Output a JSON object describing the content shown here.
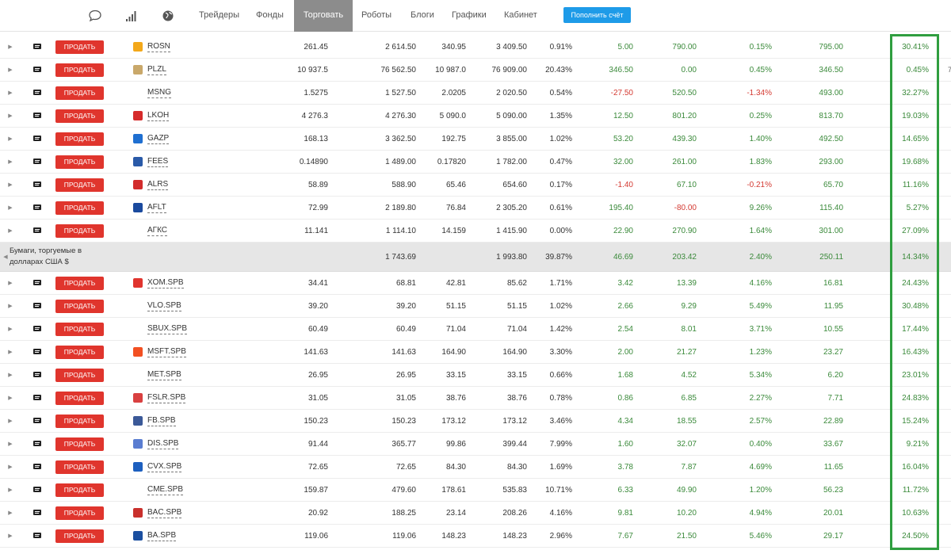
{
  "nav": {
    "links": [
      "Трейдеры",
      "Фонды",
      "Торговать",
      "Роботы",
      "Блоги",
      "Графики",
      "Кабинет"
    ],
    "fund_button": "Пополнить счёт"
  },
  "sell_label": "ПРОДАТЬ",
  "edge_mark": "7",
  "rows": [
    {
      "ticker": "ROSN",
      "v1": "261.45",
      "v2": "2 614.50",
      "v3": "340.95",
      "v4": "3 409.50",
      "v5": "0.91%",
      "v6": "5.00",
      "v7": "790.00",
      "v8": "0.15%",
      "v9": "795.00",
      "v10": "30.41%"
    },
    {
      "ticker": "PLZL",
      "v1": "10 937.5",
      "v2": "76 562.50",
      "v3": "10 987.0",
      "v4": "76 909.00",
      "v5": "20.43%",
      "v6": "346.50",
      "v7": "0.00",
      "v8": "0.45%",
      "v9": "346.50",
      "v10": "0.45%"
    },
    {
      "ticker": "MSNG",
      "v1": "1.5275",
      "v2": "1 527.50",
      "v3": "2.0205",
      "v4": "2 020.50",
      "v5": "0.54%",
      "v6": "-27.50",
      "v7": "520.50",
      "v8": "-1.34%",
      "v9": "493.00",
      "v10": "32.27%"
    },
    {
      "ticker": "LKOH",
      "v1": "4 276.3",
      "v2": "4 276.30",
      "v3": "5 090.0",
      "v4": "5 090.00",
      "v5": "1.35%",
      "v6": "12.50",
      "v7": "801.20",
      "v8": "0.25%",
      "v9": "813.70",
      "v10": "19.03%"
    },
    {
      "ticker": "GAZP",
      "v1": "168.13",
      "v2": "3 362.50",
      "v3": "192.75",
      "v4": "3 855.00",
      "v5": "1.02%",
      "v6": "53.20",
      "v7": "439.30",
      "v8": "1.40%",
      "v9": "492.50",
      "v10": "14.65%"
    },
    {
      "ticker": "FEES",
      "v1": "0.14890",
      "v2": "1 489.00",
      "v3": "0.17820",
      "v4": "1 782.00",
      "v5": "0.47%",
      "v6": "32.00",
      "v7": "261.00",
      "v8": "1.83%",
      "v9": "293.00",
      "v10": "19.68%"
    },
    {
      "ticker": "ALRS",
      "v1": "58.89",
      "v2": "588.90",
      "v3": "65.46",
      "v4": "654.60",
      "v5": "0.17%",
      "v6": "-1.40",
      "v7": "67.10",
      "v8": "-0.21%",
      "v9": "65.70",
      "v10": "11.16%"
    },
    {
      "ticker": "AFLT",
      "v1": "72.99",
      "v2": "2 189.80",
      "v3": "76.84",
      "v4": "2 305.20",
      "v5": "0.61%",
      "v6": "195.40",
      "v7": "-80.00",
      "v8": "9.26%",
      "v9": "115.40",
      "v10": "5.27%"
    },
    {
      "ticker": "АГКС",
      "v1": "11.141",
      "v2": "1 114.10",
      "v3": "14.159",
      "v4": "1 415.90",
      "v5": "0.00%",
      "v6": "22.90",
      "v7": "270.90",
      "v8": "1.64%",
      "v9": "301.00",
      "v10": "27.09%"
    }
  ],
  "group": {
    "label": "Бумаги, торгуемые в долларах США $",
    "v2": "1 743.69",
    "v4": "1 993.80",
    "v5": "39.87%",
    "v6": "46.69",
    "v7": "203.42",
    "v8": "2.40%",
    "v9": "250.11",
    "v10": "14.34%"
  },
  "rows_usd": [
    {
      "ticker": "XOM.SPB",
      "v1": "34.41",
      "v2": "68.81",
      "v3": "42.81",
      "v4": "85.62",
      "v5": "1.71%",
      "v6": "3.42",
      "v7": "13.39",
      "v8": "4.16%",
      "v9": "16.81",
      "v10": "24.43%"
    },
    {
      "ticker": "VLO.SPB",
      "v1": "39.20",
      "v2": "39.20",
      "v3": "51.15",
      "v4": "51.15",
      "v5": "1.02%",
      "v6": "2.66",
      "v7": "9.29",
      "v8": "5.49%",
      "v9": "11.95",
      "v10": "30.48%"
    },
    {
      "ticker": "SBUX.SPB",
      "v1": "60.49",
      "v2": "60.49",
      "v3": "71.04",
      "v4": "71.04",
      "v5": "1.42%",
      "v6": "2.54",
      "v7": "8.01",
      "v8": "3.71%",
      "v9": "10.55",
      "v10": "17.44%"
    },
    {
      "ticker": "MSFT.SPB",
      "v1": "141.63",
      "v2": "141.63",
      "v3": "164.90",
      "v4": "164.90",
      "v5": "3.30%",
      "v6": "2.00",
      "v7": "21.27",
      "v8": "1.23%",
      "v9": "23.27",
      "v10": "16.43%"
    },
    {
      "ticker": "MET.SPB",
      "v1": "26.95",
      "v2": "26.95",
      "v3": "33.15",
      "v4": "33.15",
      "v5": "0.66%",
      "v6": "1.68",
      "v7": "4.52",
      "v8": "5.34%",
      "v9": "6.20",
      "v10": "23.01%"
    },
    {
      "ticker": "FSLR.SPB",
      "v1": "31.05",
      "v2": "31.05",
      "v3": "38.76",
      "v4": "38.76",
      "v5": "0.78%",
      "v6": "0.86",
      "v7": "6.85",
      "v8": "2.27%",
      "v9": "7.71",
      "v10": "24.83%"
    },
    {
      "ticker": "FB.SPB",
      "v1": "150.23",
      "v2": "150.23",
      "v3": "173.12",
      "v4": "173.12",
      "v5": "3.46%",
      "v6": "4.34",
      "v7": "18.55",
      "v8": "2.57%",
      "v9": "22.89",
      "v10": "15.24%"
    },
    {
      "ticker": "DIS.SPB",
      "v1": "91.44",
      "v2": "365.77",
      "v3": "99.86",
      "v4": "399.44",
      "v5": "7.99%",
      "v6": "1.60",
      "v7": "32.07",
      "v8": "0.40%",
      "v9": "33.67",
      "v10": "9.21%"
    },
    {
      "ticker": "CVX.SPB",
      "v1": "72.65",
      "v2": "72.65",
      "v3": "84.30",
      "v4": "84.30",
      "v5": "1.69%",
      "v6": "3.78",
      "v7": "7.87",
      "v8": "4.69%",
      "v9": "11.65",
      "v10": "16.04%"
    },
    {
      "ticker": "CME.SPB",
      "v1": "159.87",
      "v2": "479.60",
      "v3": "178.61",
      "v4": "535.83",
      "v5": "10.71%",
      "v6": "6.33",
      "v7": "49.90",
      "v8": "1.20%",
      "v9": "56.23",
      "v10": "11.72%"
    },
    {
      "ticker": "BAC.SPB",
      "v1": "20.92",
      "v2": "188.25",
      "v3": "23.14",
      "v4": "208.26",
      "v5": "4.16%",
      "v6": "9.81",
      "v7": "10.20",
      "v8": "4.94%",
      "v9": "20.01",
      "v10": "10.63%"
    },
    {
      "ticker": "BA.SPB",
      "v1": "119.06",
      "v2": "119.06",
      "v3": "148.23",
      "v4": "148.23",
      "v5": "2.96%",
      "v6": "7.67",
      "v7": "21.50",
      "v8": "5.46%",
      "v9": "29.17",
      "v10": "24.50%"
    }
  ],
  "logo_colors": {
    "ROSN": "#f3a81a",
    "PLZL": "#c9a86a",
    "LKOH": "#d62b2b",
    "GAZP": "#1f6fd1",
    "FEES": "#2a5aa8",
    "ALRS": "#d22c2c",
    "AFLT": "#1a4a9e",
    "XOM.SPB": "#e0342e",
    "FSLR.SPB": "#d94040",
    "FB.SPB": "#3b5998",
    "DIS.SPB": "#5a7dd1",
    "CVX.SPB": "#1d5fbf",
    "BAC.SPB": "#c9302c",
    "BA.SPB": "#1b4fa0",
    "MSFT.SPB": "#f25022"
  }
}
